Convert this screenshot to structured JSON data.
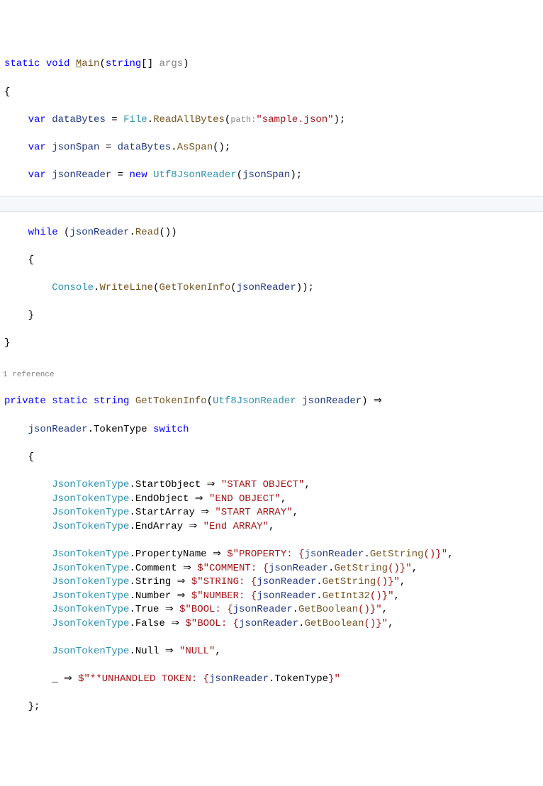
{
  "l1": {
    "kw1": "static",
    "kw2": "void",
    "method": "M",
    "methodRest": "ain",
    "type": "string",
    "param": "args"
  },
  "l3": {
    "kw": "var",
    "local": "dataBytes",
    "type": "File",
    "method": "ReadAllBytes",
    "hint": "path:",
    "str": "\"sample.json\""
  },
  "l4": {
    "kw": "var",
    "local": "jsonSpan",
    "src": "dataBytes",
    "method": "AsSpan"
  },
  "l5": {
    "kw1": "var",
    "local": "jsonReader",
    "kw2": "new",
    "type": "Utf8JsonReader",
    "arg": "jsonSpan"
  },
  "l7": {
    "kw": "while",
    "local": "jsonReader",
    "method": "Read"
  },
  "l9": {
    "type": "Console",
    "method": "WriteLine",
    "call": "GetTokenInfo",
    "arg": "jsonReader"
  },
  "codelens": "1 reference",
  "l13": {
    "kw1": "private",
    "kw2": "static",
    "kw3": "string",
    "method": "GetTokenInfo",
    "ptype": "Utf8JsonReader",
    "pname": "jsonReader"
  },
  "l14": {
    "local": "jsonReader",
    "prop": "TokenType",
    "kw": "switch"
  },
  "cases": [
    {
      "type": "JsonTokenType",
      "member": "StartObject",
      "str": "\"START OBJECT\""
    },
    {
      "type": "JsonTokenType",
      "member": "EndObject",
      "str": "\"END OBJECT\""
    },
    {
      "type": "JsonTokenType",
      "member": "StartArray",
      "str": "\"START ARRAY\""
    },
    {
      "type": "JsonTokenType",
      "member": "EndArray",
      "str": "\"End ARRAY\""
    }
  ],
  "interp": [
    {
      "type": "JsonTokenType",
      "member": "PropertyName",
      "prefix": "$\"PROPERTY: {",
      "local": "jsonReader",
      "method": "GetString",
      "suffix": "()}\""
    },
    {
      "type": "JsonTokenType",
      "member": "Comment",
      "prefix": "$\"COMMENT: {",
      "local": "jsonReader",
      "method": "GetString",
      "suffix": "()}\""
    },
    {
      "type": "JsonTokenType",
      "member": "String",
      "prefix": "$\"STRING: {",
      "local": "jsonReader",
      "method": "GetString",
      "suffix": "()}\""
    },
    {
      "type": "JsonTokenType",
      "member": "Number",
      "prefix": "$\"NUMBER: {",
      "local": "jsonReader",
      "method": "GetInt32",
      "suffix": "()}\""
    },
    {
      "type": "JsonTokenType",
      "member": "True",
      "prefix": "$\"BOOL: {",
      "local": "jsonReader",
      "method": "GetBoolean",
      "suffix": "()}\""
    },
    {
      "type": "JsonTokenType",
      "member": "False",
      "prefix": "$\"BOOL: {",
      "local": "jsonReader",
      "method": "GetBoolean",
      "suffix": "()}\""
    }
  ],
  "nullcase": {
    "type": "JsonTokenType",
    "member": "Null",
    "str": "\"NULL\""
  },
  "default": {
    "prefix": "$\"**UNHANDLED TOKEN: {",
    "local": "jsonReader",
    "prop": "TokenType",
    "suffix": "}\""
  }
}
